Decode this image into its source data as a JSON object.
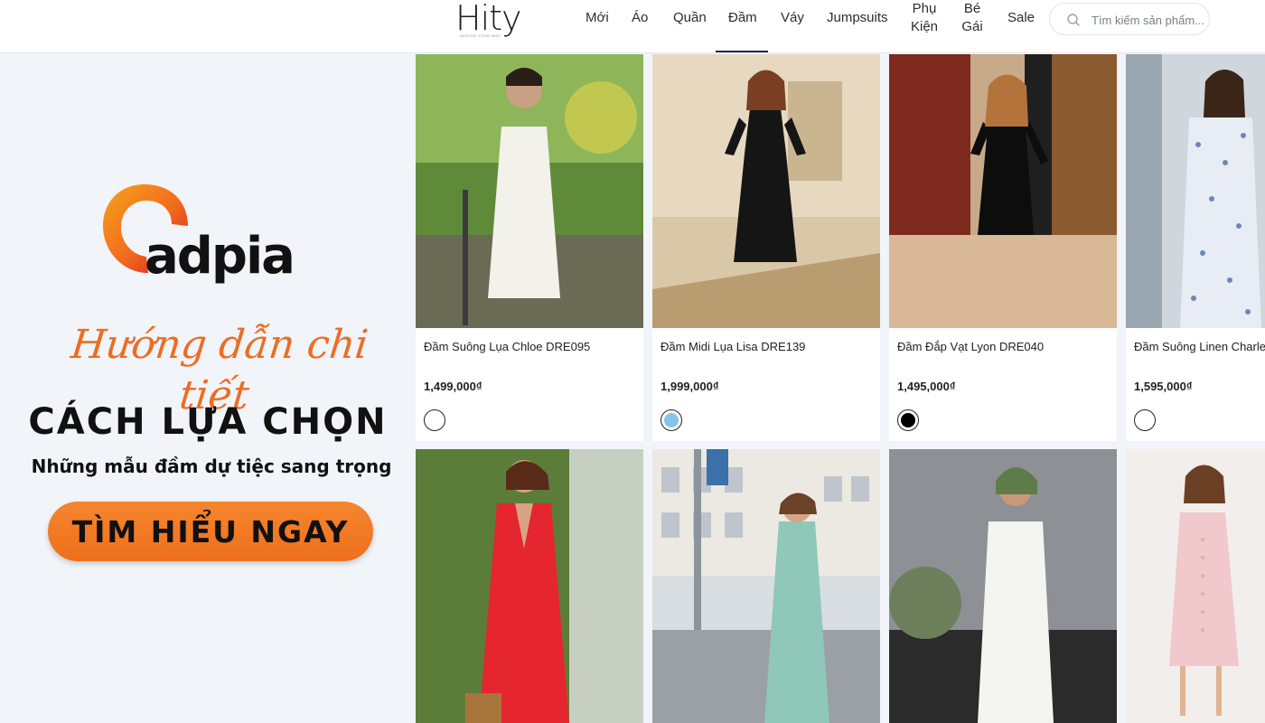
{
  "header": {
    "logo": "Hity",
    "logo_tagline": "DESIGN YOUR WAY",
    "nav": [
      "Mới",
      "Áo",
      "Quần",
      "Đầm",
      "Váy",
      "Jumpsuits",
      "Phụ Kiện",
      "Bé Gái",
      "Sale"
    ],
    "active_nav": "Đầm",
    "search_placeholder": "Tìm kiếm sản phẩm..."
  },
  "banner": {
    "brand": "adpia",
    "script_title": "Hướng dẫn chi tiết",
    "title": "CÁCH LỰA CHỌN",
    "subtitle": "Những mẫu đầm dự tiệc sang trọng",
    "cta": "TÌM HIỂU NGAY",
    "colors": {
      "accent": "#ee6f1b",
      "brand_red": "#e1251b",
      "brand_orange": "#f7941d"
    }
  },
  "products": [
    {
      "name": "Đầm Suông Lụa Chloe DRE095",
      "price": "1,499,000₫",
      "swatch": "#ffffff",
      "icon": "white-dress-photo"
    },
    {
      "name": "Đầm Midi Lụa Lisa DRE139",
      "price": "1,999,000₫",
      "swatch": "#87c3e8",
      "icon": "black-midi-dress-photo"
    },
    {
      "name": "Đầm Đắp Vạt Lyon DRE040",
      "price": "1,495,000₫",
      "swatch": "#000000",
      "icon": "black-wrap-dress-photo"
    },
    {
      "name": "Đầm Suông Linen Charles",
      "price": "1,595,000₫",
      "swatch": "#ffffff",
      "icon": "floral-dress-photo"
    }
  ],
  "products_row2": [
    {
      "icon": "red-dress-photo"
    },
    {
      "icon": "mint-shirt-dress-photo"
    },
    {
      "icon": "white-linen-dress-photo"
    },
    {
      "icon": "pink-dress-photo"
    }
  ]
}
